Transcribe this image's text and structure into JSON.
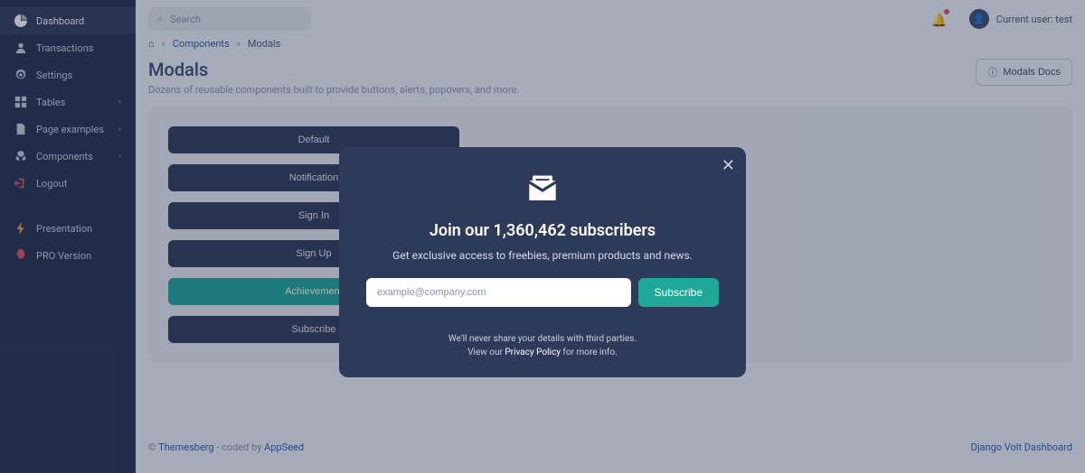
{
  "sidebar": {
    "items": [
      {
        "label": "Dashboard",
        "icon": "pie"
      },
      {
        "label": "Transactions",
        "icon": "user"
      },
      {
        "label": "Settings",
        "icon": "gear"
      },
      {
        "label": "Tables",
        "icon": "grid",
        "expandable": true
      },
      {
        "label": "Page examples",
        "icon": "page",
        "expandable": true
      },
      {
        "label": "Components",
        "icon": "cubes",
        "expandable": true
      },
      {
        "label": "Logout",
        "icon": "logout"
      }
    ],
    "extras": [
      {
        "label": "Presentation",
        "icon": "bolt"
      },
      {
        "label": "PRO Version",
        "icon": "rocket"
      }
    ]
  },
  "topbar": {
    "search_placeholder": "Search",
    "user_label": "Current user: test"
  },
  "breadcrumb": {
    "link": "Components",
    "current": "Modals"
  },
  "page": {
    "title": "Modals",
    "subtitle": "Dozens of reusable components built to provide buttons, alerts, popovers, and more.",
    "docs_btn": "Modals Docs"
  },
  "demo_buttons": [
    "Default",
    "Notification",
    "Sign In",
    "Sign Up",
    "Achievement",
    "Subscribe"
  ],
  "footer": {
    "left_prefix": "© ",
    "left_link1": "Themesberg",
    "left_mid": " - coded by ",
    "left_link2": "AppSeed",
    "right": "Django Volt Dashboard"
  },
  "modal": {
    "title": "Join our 1,360,462 subscribers",
    "text": "Get exclusive access to freebies, premium products and news.",
    "input_placeholder": "example@company.com",
    "submit": "Subscribe",
    "footer_line1": "We'll never share your details with third parties.",
    "footer_line2a": "View our ",
    "footer_line2_link": "Privacy Policy",
    "footer_line2b": " for more info."
  }
}
